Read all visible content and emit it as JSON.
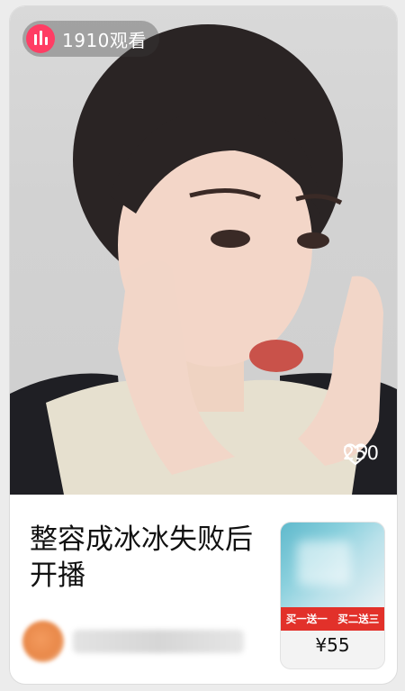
{
  "card": {
    "views_text": "1910观看",
    "likes_count": "250",
    "title": "整容成冰冰失败后开播",
    "product": {
      "promo_left": "买一送一",
      "promo_right": "买二送三",
      "price": "¥55"
    }
  },
  "colors": {
    "live_badge": "#ff3d64",
    "promo_red": "#e2312a"
  }
}
